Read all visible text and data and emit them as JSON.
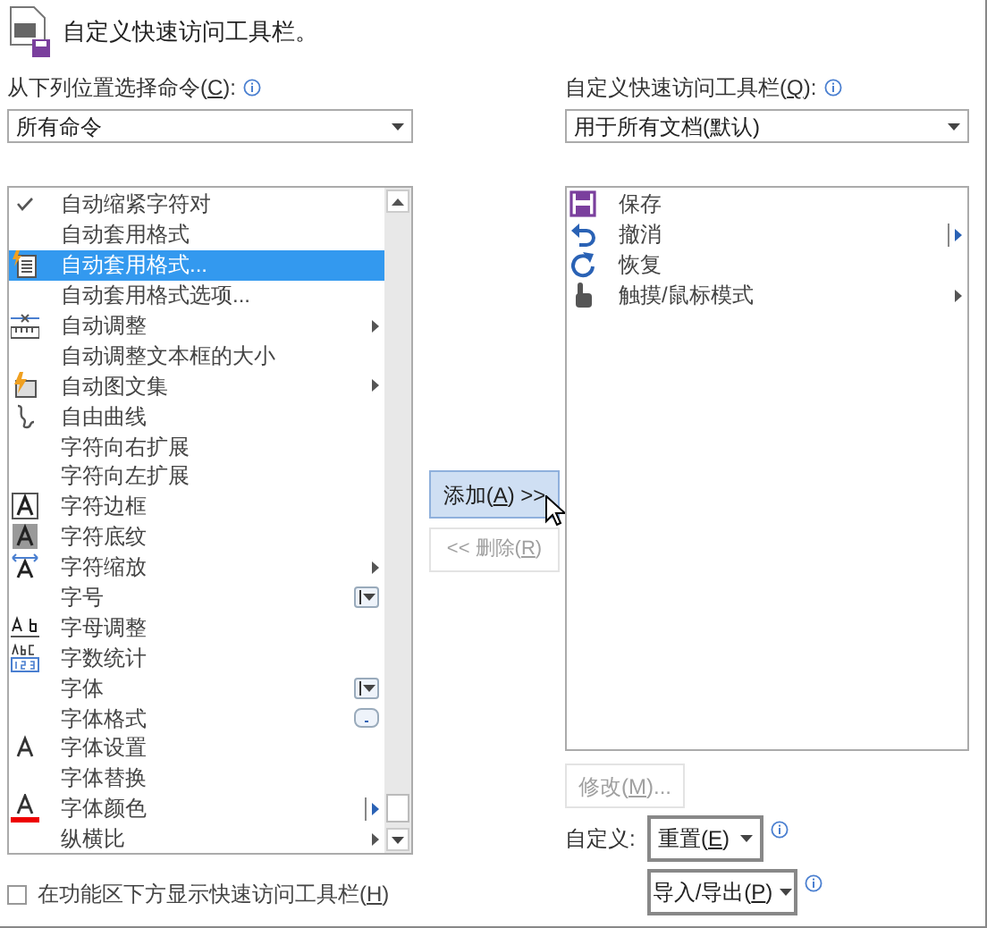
{
  "title": "自定义快速访问工具栏。",
  "left": {
    "label": {
      "before": "从下列位置选择命令(",
      "mnemonic": "C",
      "after": "):"
    },
    "dropdown": "所有命令",
    "items": [
      {
        "label": "自动缩紧字符对",
        "kind": "check",
        "selected": false
      },
      {
        "label": "自动套用格式",
        "kind": "none",
        "selected": false
      },
      {
        "label": "自动套用格式...",
        "kind": "autoformat",
        "selected": true
      },
      {
        "label": "自动套用格式选项...",
        "kind": "none",
        "selected": false
      },
      {
        "label": "自动调整",
        "kind": "ruler",
        "selected": false,
        "submenu": true
      },
      {
        "label": "自动调整文本框的大小",
        "kind": "none",
        "selected": false
      },
      {
        "label": "自动图文集",
        "kind": "autotext",
        "selected": false,
        "submenu": true
      },
      {
        "label": "自由曲线",
        "kind": "curve",
        "selected": false
      },
      {
        "label": "字符向右扩展",
        "kind": "none",
        "selected": false
      },
      {
        "label": "字符向左扩展",
        "kind": "none",
        "selected": false
      },
      {
        "label": "字符边框",
        "kind": "boxed-a",
        "selected": false
      },
      {
        "label": "字符底纹",
        "kind": "shaded-a",
        "selected": false
      },
      {
        "label": "字符缩放",
        "kind": "scale-a",
        "selected": false,
        "submenu": true
      },
      {
        "label": "字号",
        "kind": "none",
        "selected": false,
        "combo_box": true
      },
      {
        "label": "字母调整",
        "kind": "ab",
        "selected": false
      },
      {
        "label": "字数统计",
        "kind": "abc123",
        "selected": false
      },
      {
        "label": "字体",
        "kind": "none",
        "selected": false,
        "combo_box": true
      },
      {
        "label": "字体格式",
        "kind": "none",
        "selected": false,
        "more_button": true
      },
      {
        "label": "字体设置",
        "kind": "plain-a",
        "selected": false
      },
      {
        "label": "字体替换",
        "kind": "none",
        "selected": false
      },
      {
        "label": "字体颜色",
        "kind": "color-a",
        "selected": false,
        "split": true
      },
      {
        "label": "纵横比",
        "kind": "none",
        "selected": false,
        "submenu": true
      }
    ],
    "checkbox": {
      "before": "在功能区下方显示快速访问工具栏(",
      "mnemonic": "H",
      "after": ")",
      "checked": false
    }
  },
  "add_button": {
    "before": "添加(",
    "mnemonic": "A",
    "after": ") >>",
    "disabled": false
  },
  "remove_button": {
    "before": "<< 删除(",
    "mnemonic": "R",
    "after": ")",
    "disabled": true
  },
  "right": {
    "label": {
      "before": "自定义快速访问工具栏(",
      "mnemonic": "Q",
      "after": "):"
    },
    "dropdown": "用于所有文档(默认)",
    "items": [
      {
        "label": "保存",
        "kind": "save",
        "split": false,
        "submenu": false
      },
      {
        "label": "撤消",
        "kind": "undo",
        "split": true,
        "submenu": false
      },
      {
        "label": "恢复",
        "kind": "redo",
        "split": false,
        "submenu": false
      },
      {
        "label": "触摸/鼠标模式",
        "kind": "touch",
        "split": false,
        "submenu": true
      }
    ],
    "modify_button": {
      "before": "修改(",
      "mnemonic": "M",
      "after": ")...",
      "disabled": true
    },
    "customize_label": "自定义:",
    "reset_button": {
      "before": "重置(",
      "mnemonic": "E",
      "after": ")",
      "disabled": false
    },
    "import_export_button": {
      "before": "导入/导出(",
      "mnemonic": "P",
      "after": ")",
      "disabled": false
    }
  }
}
